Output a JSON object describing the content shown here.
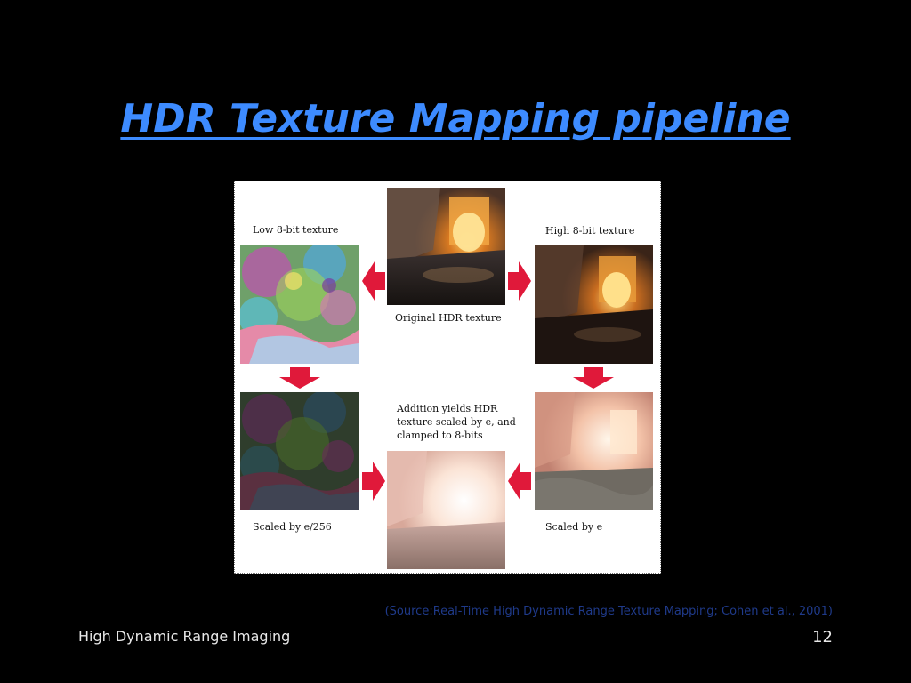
{
  "slide": {
    "title": "HDR Texture Mapping pipeline",
    "source": "(Source:Real-Time High Dynamic Range Texture Mapping; Cohen et al., 2001)",
    "footer": "High Dynamic Range Imaging",
    "page_number": "12"
  },
  "figure": {
    "captions": {
      "low_texture": "Low 8-bit texture",
      "high_texture": "High 8-bit texture",
      "original": "Original HDR texture",
      "addition": "Addition yields HDR\ntexture scaled by e, and\nclamped to 8-bits",
      "scaled_low": "Scaled by e/256",
      "scaled_high": "Scaled by e"
    },
    "arrow_color": "#e0193a"
  },
  "colors": {
    "background": "#000000",
    "title": "#3d8bff",
    "source": "#1f3a8a",
    "footer": "#e8e8e8"
  }
}
